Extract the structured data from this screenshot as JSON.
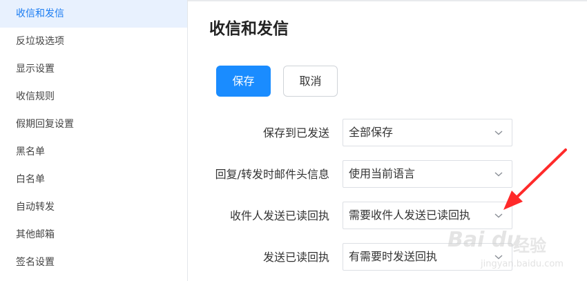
{
  "sidebar": {
    "items": [
      {
        "label": "收信和发信",
        "active": true
      },
      {
        "label": "反垃圾选项"
      },
      {
        "label": "显示设置"
      },
      {
        "label": "收信规则"
      },
      {
        "label": "假期回复设置"
      },
      {
        "label": "黑名单"
      },
      {
        "label": "白名单"
      },
      {
        "label": "自动转发"
      },
      {
        "label": "其他邮箱"
      },
      {
        "label": "签名设置"
      }
    ]
  },
  "main": {
    "title": "收信和发信",
    "save_label": "保存",
    "cancel_label": "取消",
    "settings": [
      {
        "label": "保存到已发送",
        "value": "全部保存"
      },
      {
        "label": "回复/转发时邮件头信息",
        "value": "使用当前语言"
      },
      {
        "label": "收件人发送已读回执",
        "value": "需要收件人发送已读回执"
      },
      {
        "label": "发送已读回执",
        "value": "有需要时发送回执"
      }
    ]
  },
  "watermark": {
    "logo": "Bai du",
    "text": "经验",
    "url": "jingyan.baidu.com"
  },
  "colors": {
    "accent": "#1a8cff",
    "active_bg": "#e8f1fe",
    "active_text": "#1a7cf2",
    "annotation_arrow": "#ff2a2a"
  },
  "icons": {
    "select_chevron": "chevron-down-icon",
    "annotation": "red-arrow-icon"
  }
}
